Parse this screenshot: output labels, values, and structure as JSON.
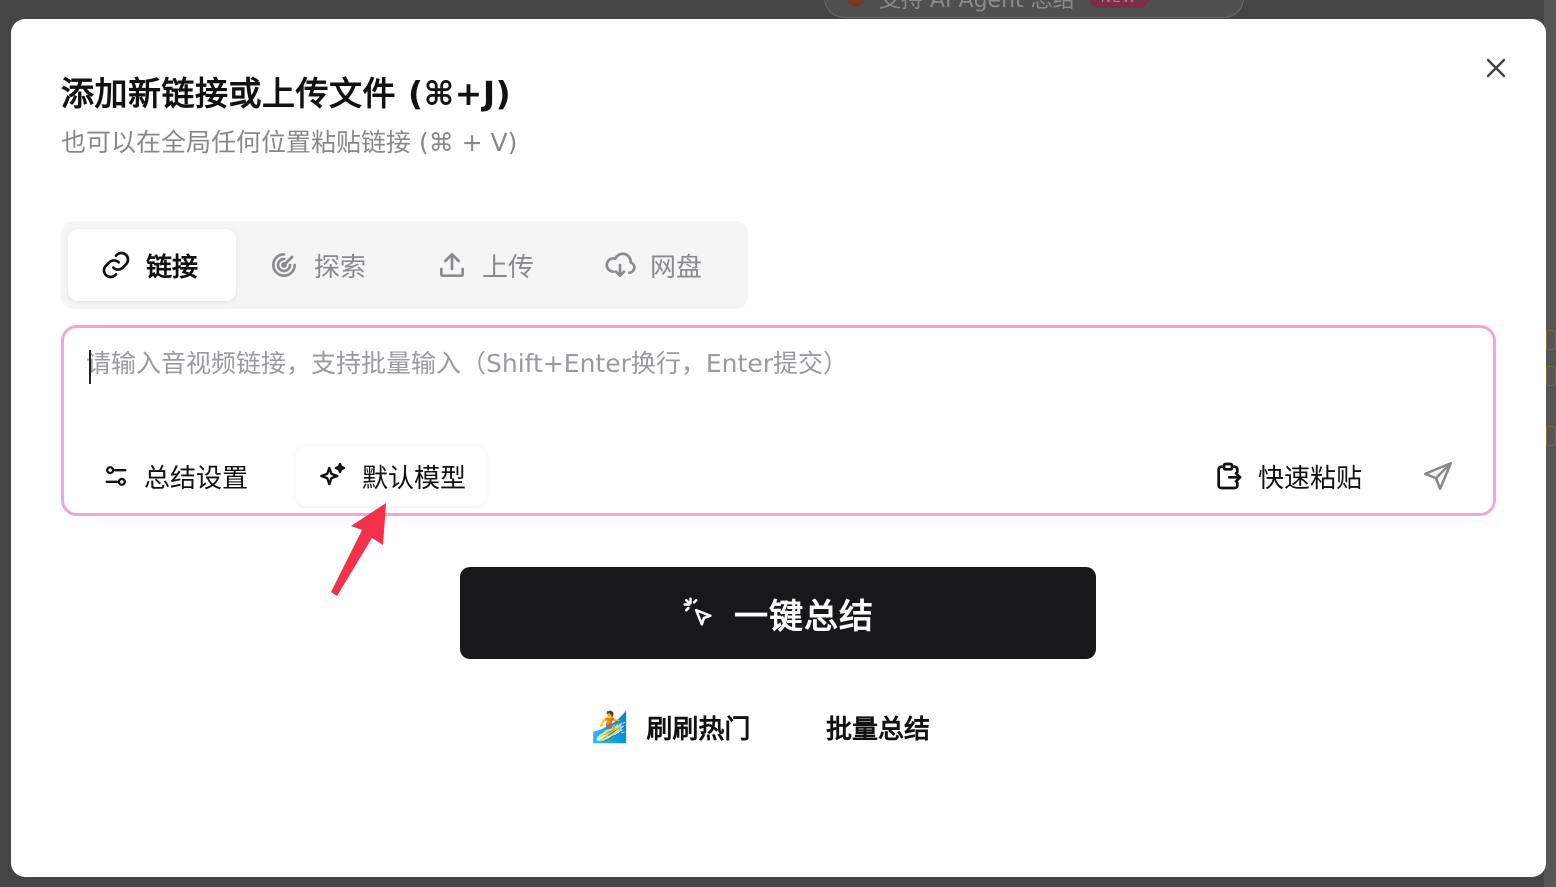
{
  "background": {
    "pill_text": "支持 AI Agent 总结",
    "pill_badge": "NEW"
  },
  "modal": {
    "title": "添加新链接或上传文件 (⌘+J)",
    "subtitle": "也可以在全局任何位置粘贴链接 (⌘ + V)",
    "close_icon": "close-icon",
    "tabs": [
      {
        "label": "链接",
        "icon": "link-icon",
        "active": true
      },
      {
        "label": "探索",
        "icon": "radar-icon",
        "active": false
      },
      {
        "label": "上传",
        "icon": "upload-icon",
        "active": false
      },
      {
        "label": "网盘",
        "icon": "cloud-download-icon",
        "active": false
      }
    ],
    "input": {
      "placeholder": "请输入音视频链接，支持批量输入（Shift+Enter换行，Enter提交）",
      "value": ""
    },
    "toolbar": {
      "summary_settings": "总结设置",
      "default_model": "默认模型",
      "quick_paste": "快速粘贴"
    },
    "primary_button": "一键总结",
    "bottom_links": {
      "trending": "刷刷热门",
      "batch": "批量总结"
    }
  },
  "colors": {
    "input_border": "#f3a6cf",
    "primary_bg": "#18181b",
    "annotation_arrow": "#f2324a"
  }
}
